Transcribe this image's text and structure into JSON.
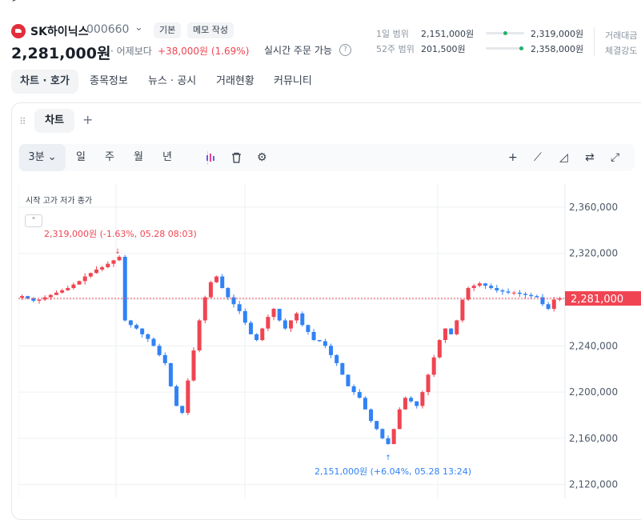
{
  "stock": {
    "name": "SK하이닉스",
    "code": "000660",
    "badge_basic": "기본",
    "badge_memo": "메모 작성",
    "price": "2,281,000원",
    "compare_label": "어제보다",
    "change": "+38,000원 (1.69%)",
    "realtime_label": "실시간 주문 가능"
  },
  "ranges": [
    {
      "label": "1일 범위",
      "low": "2,151,000원",
      "high": "2,319,000원",
      "marker": 0.5
    },
    {
      "label": "52주 범위",
      "low": "201,500원",
      "high": "2,358,000원",
      "marker": 0.98
    }
  ],
  "side_labels": [
    "거래대금",
    "체결강도"
  ],
  "tabs": [
    "차트 · 호가",
    "종목정보",
    "뉴스 · 공시",
    "거래현황",
    "커뮤니티"
  ],
  "chart_tab_label": "차트",
  "timeframes": [
    "3분",
    "일",
    "주",
    "월",
    "년"
  ],
  "legend_text": "시작 고가 저가 종가",
  "colors": {
    "up": "#f04452",
    "down": "#3182f6",
    "grid": "#eef0f3"
  },
  "chart_data": {
    "type": "candlestick",
    "y_ticks": [
      2360000,
      2320000,
      2280000,
      2240000,
      2200000,
      2160000,
      2120000
    ],
    "ylim": [
      2108000,
      2380000
    ],
    "current_price": 2281000,
    "current_label": "2,281,000",
    "high_annotation": "2,319,000원 (-1.63%, 05.28 08:03)",
    "low_annotation": "2,151,000원 (+6.04%, 05.28 13:24)",
    "high_value": 2319000,
    "low_value": 2151000,
    "close_path": [
      2283000,
      2281000,
      2279000,
      2280000,
      2282000,
      2284000,
      2286000,
      2288000,
      2290000,
      2293000,
      2296000,
      2300000,
      2303000,
      2306000,
      2308000,
      2311000,
      2314000,
      2317000,
      2262000,
      2258000,
      2255000,
      2250000,
      2246000,
      2240000,
      2232000,
      2225000,
      2205000,
      2188000,
      2182000,
      2210000,
      2236000,
      2262000,
      2282000,
      2295000,
      2300000,
      2290000,
      2282000,
      2276000,
      2270000,
      2260000,
      2250000,
      2245000,
      2255000,
      2265000,
      2272000,
      2262000,
      2255000,
      2262000,
      2268000,
      2258000,
      2252000,
      2245000,
      2244000,
      2240000,
      2232000,
      2225000,
      2215000,
      2205000,
      2200000,
      2195000,
      2185000,
      2175000,
      2168000,
      2160000,
      2155000,
      2168000,
      2185000,
      2195000,
      2192000,
      2188000,
      2200000,
      2215000,
      2230000,
      2245000,
      2255000,
      2250000,
      2262000,
      2280000,
      2290000,
      2292000,
      2294000,
      2292000,
      2290000,
      2288000,
      2287000,
      2286000,
      2286000,
      2285000,
      2284000,
      2283000,
      2282000,
      2276000,
      2272000,
      2280000,
      2281000
    ]
  }
}
